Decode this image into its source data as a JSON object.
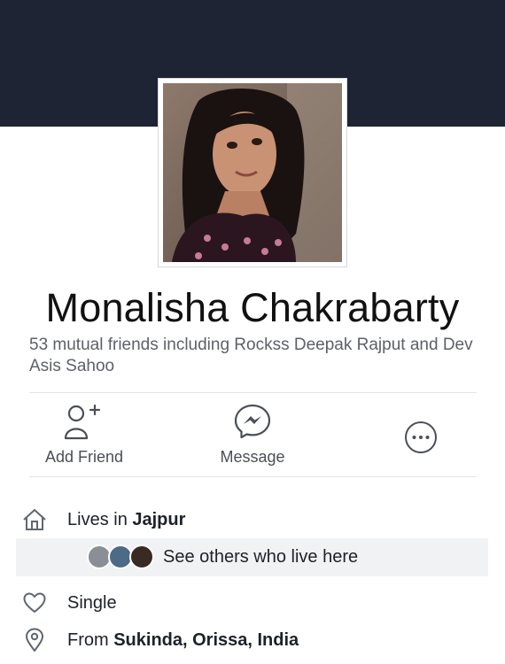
{
  "profile": {
    "name": "Monalisha Chakrabarty",
    "mutual_friends": "53 mutual friends including Rockss Deepak Rajput and Dev Asis Sahoo"
  },
  "actions": {
    "add_friend": "Add Friend",
    "message": "Message",
    "more_icon": "more-icon"
  },
  "info": {
    "lives_prefix": "Lives in ",
    "lives_place": "Jajpur",
    "see_others": "See others who live here",
    "relationship": "Single",
    "from_prefix": "From ",
    "from_place": "Sukinda, Orissa, India"
  },
  "colors": {
    "cover": "#1e2433",
    "icon": "#606770",
    "messenger_blue": "#4b4f56"
  }
}
